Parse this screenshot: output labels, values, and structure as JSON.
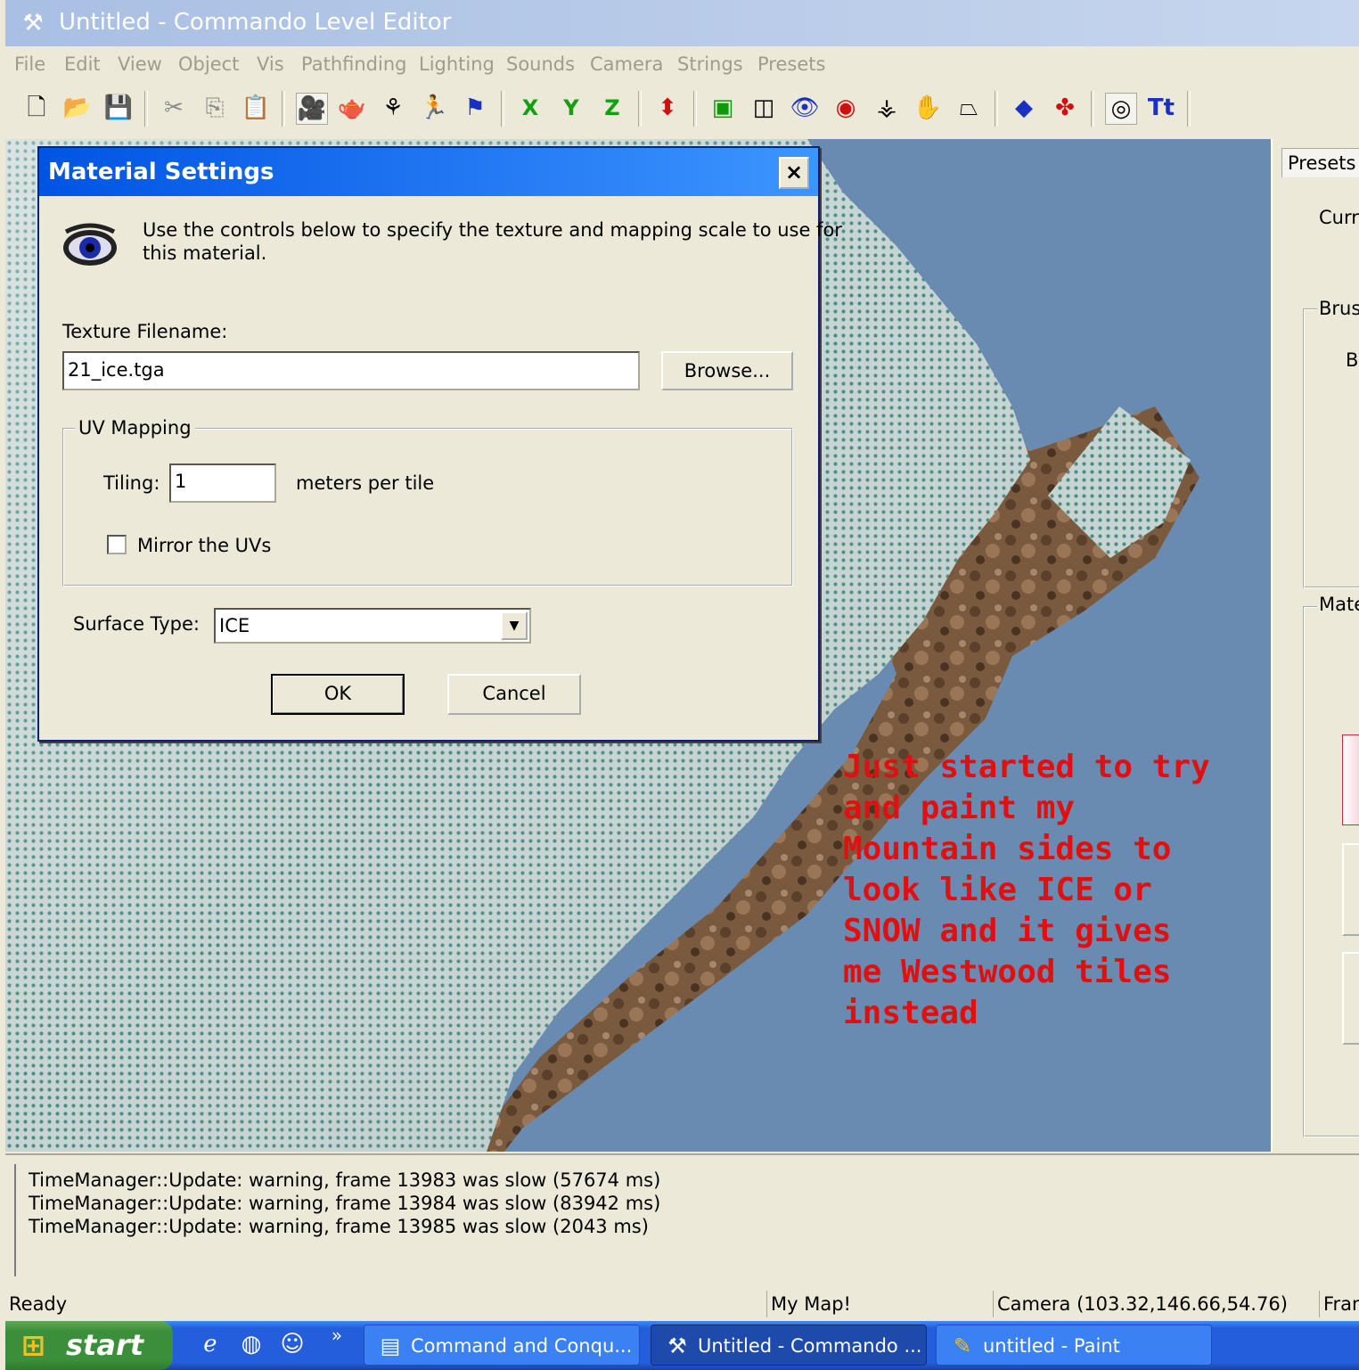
{
  "window": {
    "title": "Untitled - Commando Level Editor",
    "icon": "tools-icon"
  },
  "menu": [
    "File",
    "Edit",
    "View",
    "Object",
    "Vis",
    "Pathfinding",
    "Lighting",
    "Sounds",
    "Camera",
    "Strings",
    "Presets"
  ],
  "toolbar": {
    "axis_x": "X",
    "axis_y": "Y",
    "axis_z": "Z",
    "icons": [
      "new-file-icon",
      "open-folder-icon",
      "save-icon",
      "cut-icon",
      "copy-icon",
      "paste-icon",
      "camera-icon",
      "teapot-icon",
      "gizmo-icon",
      "walk-icon",
      "flag-icon",
      "axis-x-icon",
      "axis-y-icon",
      "axis-z-icon",
      "arrow-up-icon",
      "solid-cube-icon",
      "wire-cube-icon",
      "eye-icon",
      "eye-red-icon",
      "tree-icon",
      "hand-icon",
      "polygon-icon",
      "color-cube-icon",
      "palette-icon",
      "vis-eye-icon",
      "text-tool-icon"
    ]
  },
  "dialog": {
    "title": "Material Settings",
    "close_symbol": "×",
    "description_line1": "Use the controls below to specify the texture and mapping scale to use for",
    "description_line2": "this material.",
    "texture_label": "Texture Filename:",
    "texture_value": "21_ice.tga",
    "browse_label": "Browse...",
    "uv_group_label": "UV Mapping",
    "tiling_label": "Tiling:",
    "tiling_value": "1",
    "tiling_unit": "meters per tile",
    "mirror_label": "Mirror the UVs",
    "mirror_checked": false,
    "surface_label": "Surface Type:",
    "surface_value": "ICE",
    "ok_label": "OK",
    "cancel_label": "Cancel"
  },
  "viewport": {
    "annotation_lines": [
      "Just started to try",
      "and paint my",
      "Mountain sides to",
      "look like ICE or",
      "SNOW and it gives",
      "me Westwood tiles",
      "instead"
    ],
    "annotation_color": "#e01010",
    "sky_color": "#6a8bb1"
  },
  "right_panel": {
    "tab": "Presets",
    "current": "Curre",
    "brush": "Brusl",
    "brush_sub": "Bı",
    "material": "Mate"
  },
  "console": {
    "lines": [
      "TimeManager::Update: warning, frame 13983 was slow (57674 ms)",
      "TimeManager::Update: warning, frame 13984 was slow (83942 ms)",
      "TimeManager::Update: warning, frame 13985 was slow (2043 ms)"
    ]
  },
  "status": {
    "ready": "Ready",
    "map": "My Map!",
    "camera": "Camera (103.32,146.66,54.76)",
    "frame": "Fran"
  },
  "taskbar": {
    "start": "start",
    "chevron": "»",
    "tasks": [
      {
        "label": "Command and Conqu...",
        "icon": "ie-window-icon",
        "active": false
      },
      {
        "label": "Untitled - Commando ...",
        "icon": "tools-icon",
        "active": true
      },
      {
        "label": "untitled - Paint",
        "icon": "paint-icon",
        "active": false
      }
    ]
  }
}
